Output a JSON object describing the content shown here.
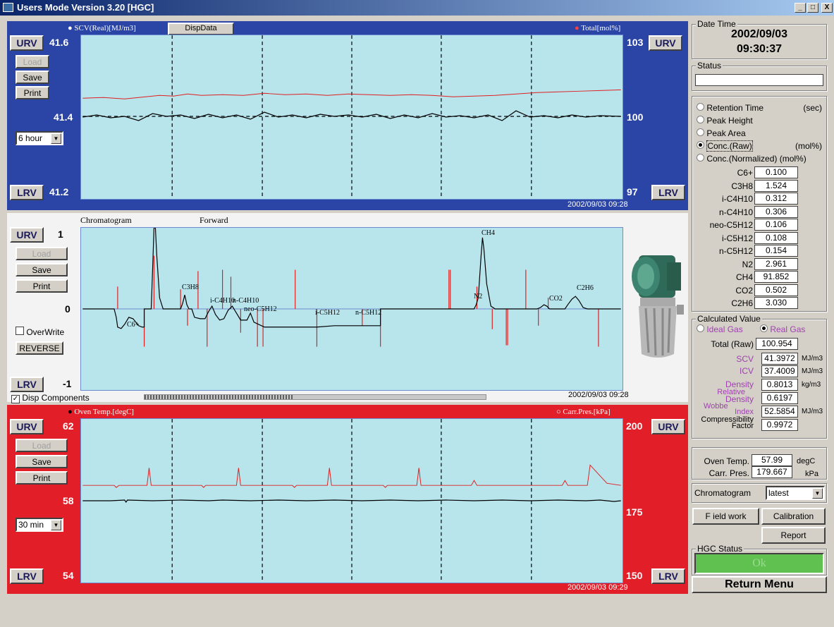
{
  "window": {
    "title": "Users Mode Version 3.20 [HGC]",
    "min": "_",
    "max": "□",
    "close": "X"
  },
  "top": {
    "left_legend": "SCV(Real)[MJ/m3]",
    "disp_button": "DispData",
    "right_legend": "Total[mol%]",
    "urv": "URV",
    "lrv": "LRV",
    "left_max": "41.6",
    "left_mid": "41.4",
    "left_min": "41.2",
    "right_max": "103",
    "right_mid": "100",
    "right_min": "97",
    "load": "Load",
    "save": "Save",
    "print": "Print",
    "range": "6 hour",
    "timestamp": "2002/09/03 09:28"
  },
  "mid": {
    "title": "Chromatogram",
    "direction": "Forward",
    "urv": "URV",
    "lrv": "LRV",
    "max": "1",
    "zero": "0",
    "min": "-1",
    "load": "Load",
    "save": "Save",
    "print": "Print",
    "overwrite": "OverWrite",
    "reverse": "REVERSE",
    "disp_components": "Disp Components",
    "timestamp": "2002/09/03 09:28",
    "peaks": [
      "C6+",
      "C3H8",
      "i-C4H10",
      "n-C4H10",
      "neo-C5H12",
      "i-C5H12",
      "n-C5H12",
      "N2",
      "CH4",
      "CO2",
      "C2H6"
    ]
  },
  "bot": {
    "left_legend": "Oven Temp.[degC]",
    "right_legend": "Carr.Pres.[kPa]",
    "urv": "URV",
    "lrv": "LRV",
    "left_max": "62",
    "left_mid": "58",
    "left_min": "54",
    "right_max": "200",
    "right_mid": "175",
    "right_min": "150",
    "load": "Load",
    "save": "Save",
    "print": "Print",
    "range": "30 min",
    "timestamp": "2002/09/03 09:29"
  },
  "side": {
    "datetime_label": "Date Time",
    "date": "2002/09/03",
    "time": "09:30:37",
    "status_label": "Status",
    "status_value": "",
    "modes": [
      {
        "label": "Retention Time",
        "unit": "(sec)",
        "on": false
      },
      {
        "label": "Peak Height",
        "unit": "",
        "on": false
      },
      {
        "label": "Peak Area",
        "unit": "",
        "on": false
      },
      {
        "label": "Conc.(Raw)",
        "unit": "(mol%)",
        "on": true
      },
      {
        "label": "Conc.(Normalized) (mol%)",
        "unit": "",
        "on": false
      }
    ],
    "components": [
      {
        "name": "C6+",
        "value": "0.100"
      },
      {
        "name": "C3H8",
        "value": "1.524"
      },
      {
        "name": "i-C4H10",
        "value": "0.312"
      },
      {
        "name": "n-C4H10",
        "value": "0.306"
      },
      {
        "name": "neo-C5H12",
        "value": "0.106"
      },
      {
        "name": "i-C5H12",
        "value": "0.108"
      },
      {
        "name": "n-C5H12",
        "value": "0.154"
      },
      {
        "name": "N2",
        "value": "2.961"
      },
      {
        "name": "CH4",
        "value": "91.852"
      },
      {
        "name": "CO2",
        "value": "0.502"
      },
      {
        "name": "C2H6",
        "value": "3.030"
      }
    ],
    "calc_label": "Calculated Value",
    "ideal_gas": "Ideal Gas",
    "real_gas": "Real Gas",
    "total_label": "Total (Raw)",
    "total": "100.954",
    "scv_label": "SCV",
    "scv": "41.3972",
    "scv_unit": "MJ/m3",
    "icv_label": "ICV",
    "icv": "37.4009",
    "icv_unit": "MJ/m3",
    "density_label": "Density",
    "density": "0.8013",
    "density_unit": "kg/m3",
    "reldens_label1": "Relative",
    "reldens_label2": "Density",
    "reldens": "0.6197",
    "wobbe_label1": "Wobbe",
    "wobbe_label2": "Index",
    "wobbe": "52.5854",
    "wobbe_unit": "MJ/m3",
    "comp_label1": "Compressibility",
    "comp_label2": "Factor",
    "comp": "0.9972",
    "oven_label": "Oven Temp.",
    "oven": "57.99",
    "oven_unit": "degC",
    "carr_label": "Carr. Pres.",
    "carr": "179.667",
    "carr_unit": "kPa",
    "chrom_label": "Chromatogram",
    "chrom_value": "latest",
    "fieldwork": "F ield work",
    "calibration": "Calibration",
    "report": "Report",
    "hgc_label": "HGC Status",
    "hgc_value": "Ok",
    "return": "Return Menu"
  }
}
